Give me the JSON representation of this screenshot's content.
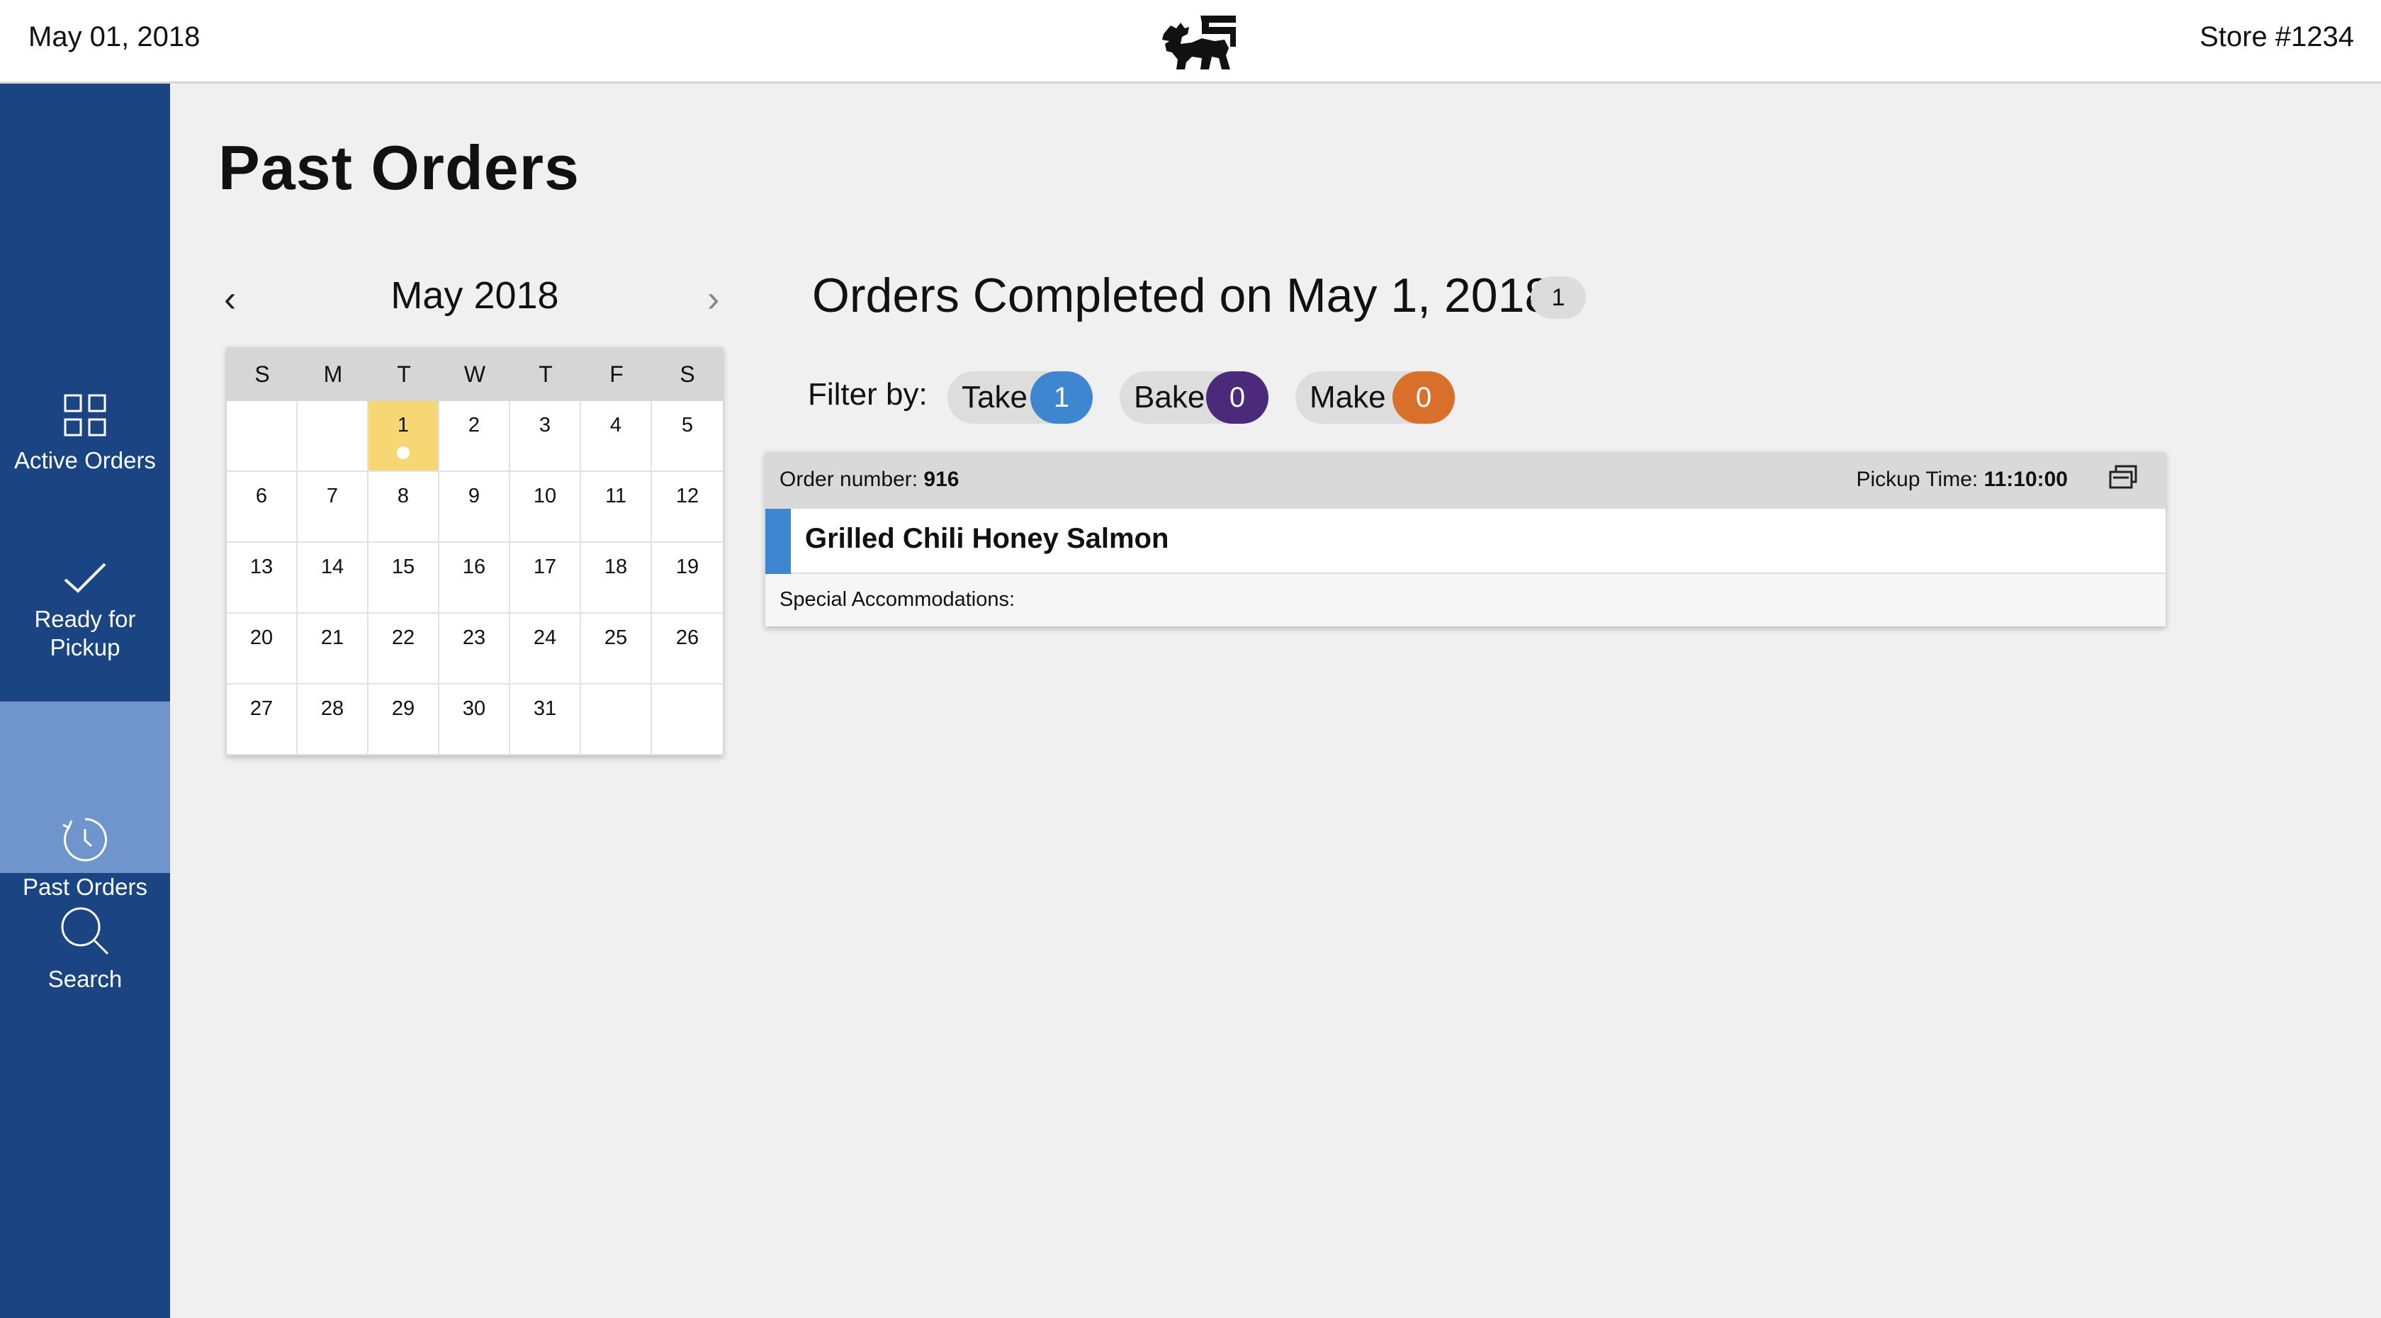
{
  "header": {
    "date": "May 01, 2018",
    "store": "Store #1234",
    "logo_icon": "lion-logo-icon"
  },
  "sidebar": {
    "items": [
      {
        "label": "Active Orders",
        "icon": "grid-icon",
        "active": false
      },
      {
        "label": "Ready for Pickup",
        "icon": "checkmark-icon",
        "active": false
      },
      {
        "label": "Past Orders",
        "icon": "history-icon",
        "active": true
      },
      {
        "label": "Search",
        "icon": "search-icon",
        "active": false
      }
    ],
    "colors": {
      "background": "#1a4482",
      "active": "#6f95cc"
    }
  },
  "page": {
    "title": "Past Orders"
  },
  "calendar": {
    "month_label": "May 2018",
    "prev_glyph": "‹",
    "next_glyph": "›",
    "weekdays": [
      "S",
      "M",
      "T",
      "W",
      "T",
      "F",
      "S"
    ],
    "days": [
      "",
      "",
      "1",
      "2",
      "3",
      "4",
      "5",
      "6",
      "7",
      "8",
      "9",
      "10",
      "11",
      "12",
      "13",
      "14",
      "15",
      "16",
      "17",
      "18",
      "19",
      "20",
      "21",
      "22",
      "23",
      "24",
      "25",
      "26",
      "27",
      "28",
      "29",
      "30",
      "31",
      "",
      ""
    ],
    "selected_day": "1",
    "selected_color": "#f7d773"
  },
  "orders": {
    "heading": "Orders Completed on May 1, 2018",
    "count": "1",
    "filter_label": "Filter by:",
    "filters": [
      {
        "label": "Take",
        "count": "1",
        "color": "#3e86cf"
      },
      {
        "label": "Bake",
        "count": "0",
        "color": "#4b2a7c"
      },
      {
        "label": "Make",
        "count": "0",
        "color": "#d86f2a"
      }
    ],
    "list": [
      {
        "number_label": "Order number:",
        "number": "916",
        "pickup_label": "Pickup Time:",
        "pickup_time": "11:10:00",
        "item": "Grilled Chili Honey Salmon",
        "item_color": "#3e86cf",
        "special_label": "Special Accommodations:",
        "print_icon": "print-icon"
      }
    ]
  }
}
